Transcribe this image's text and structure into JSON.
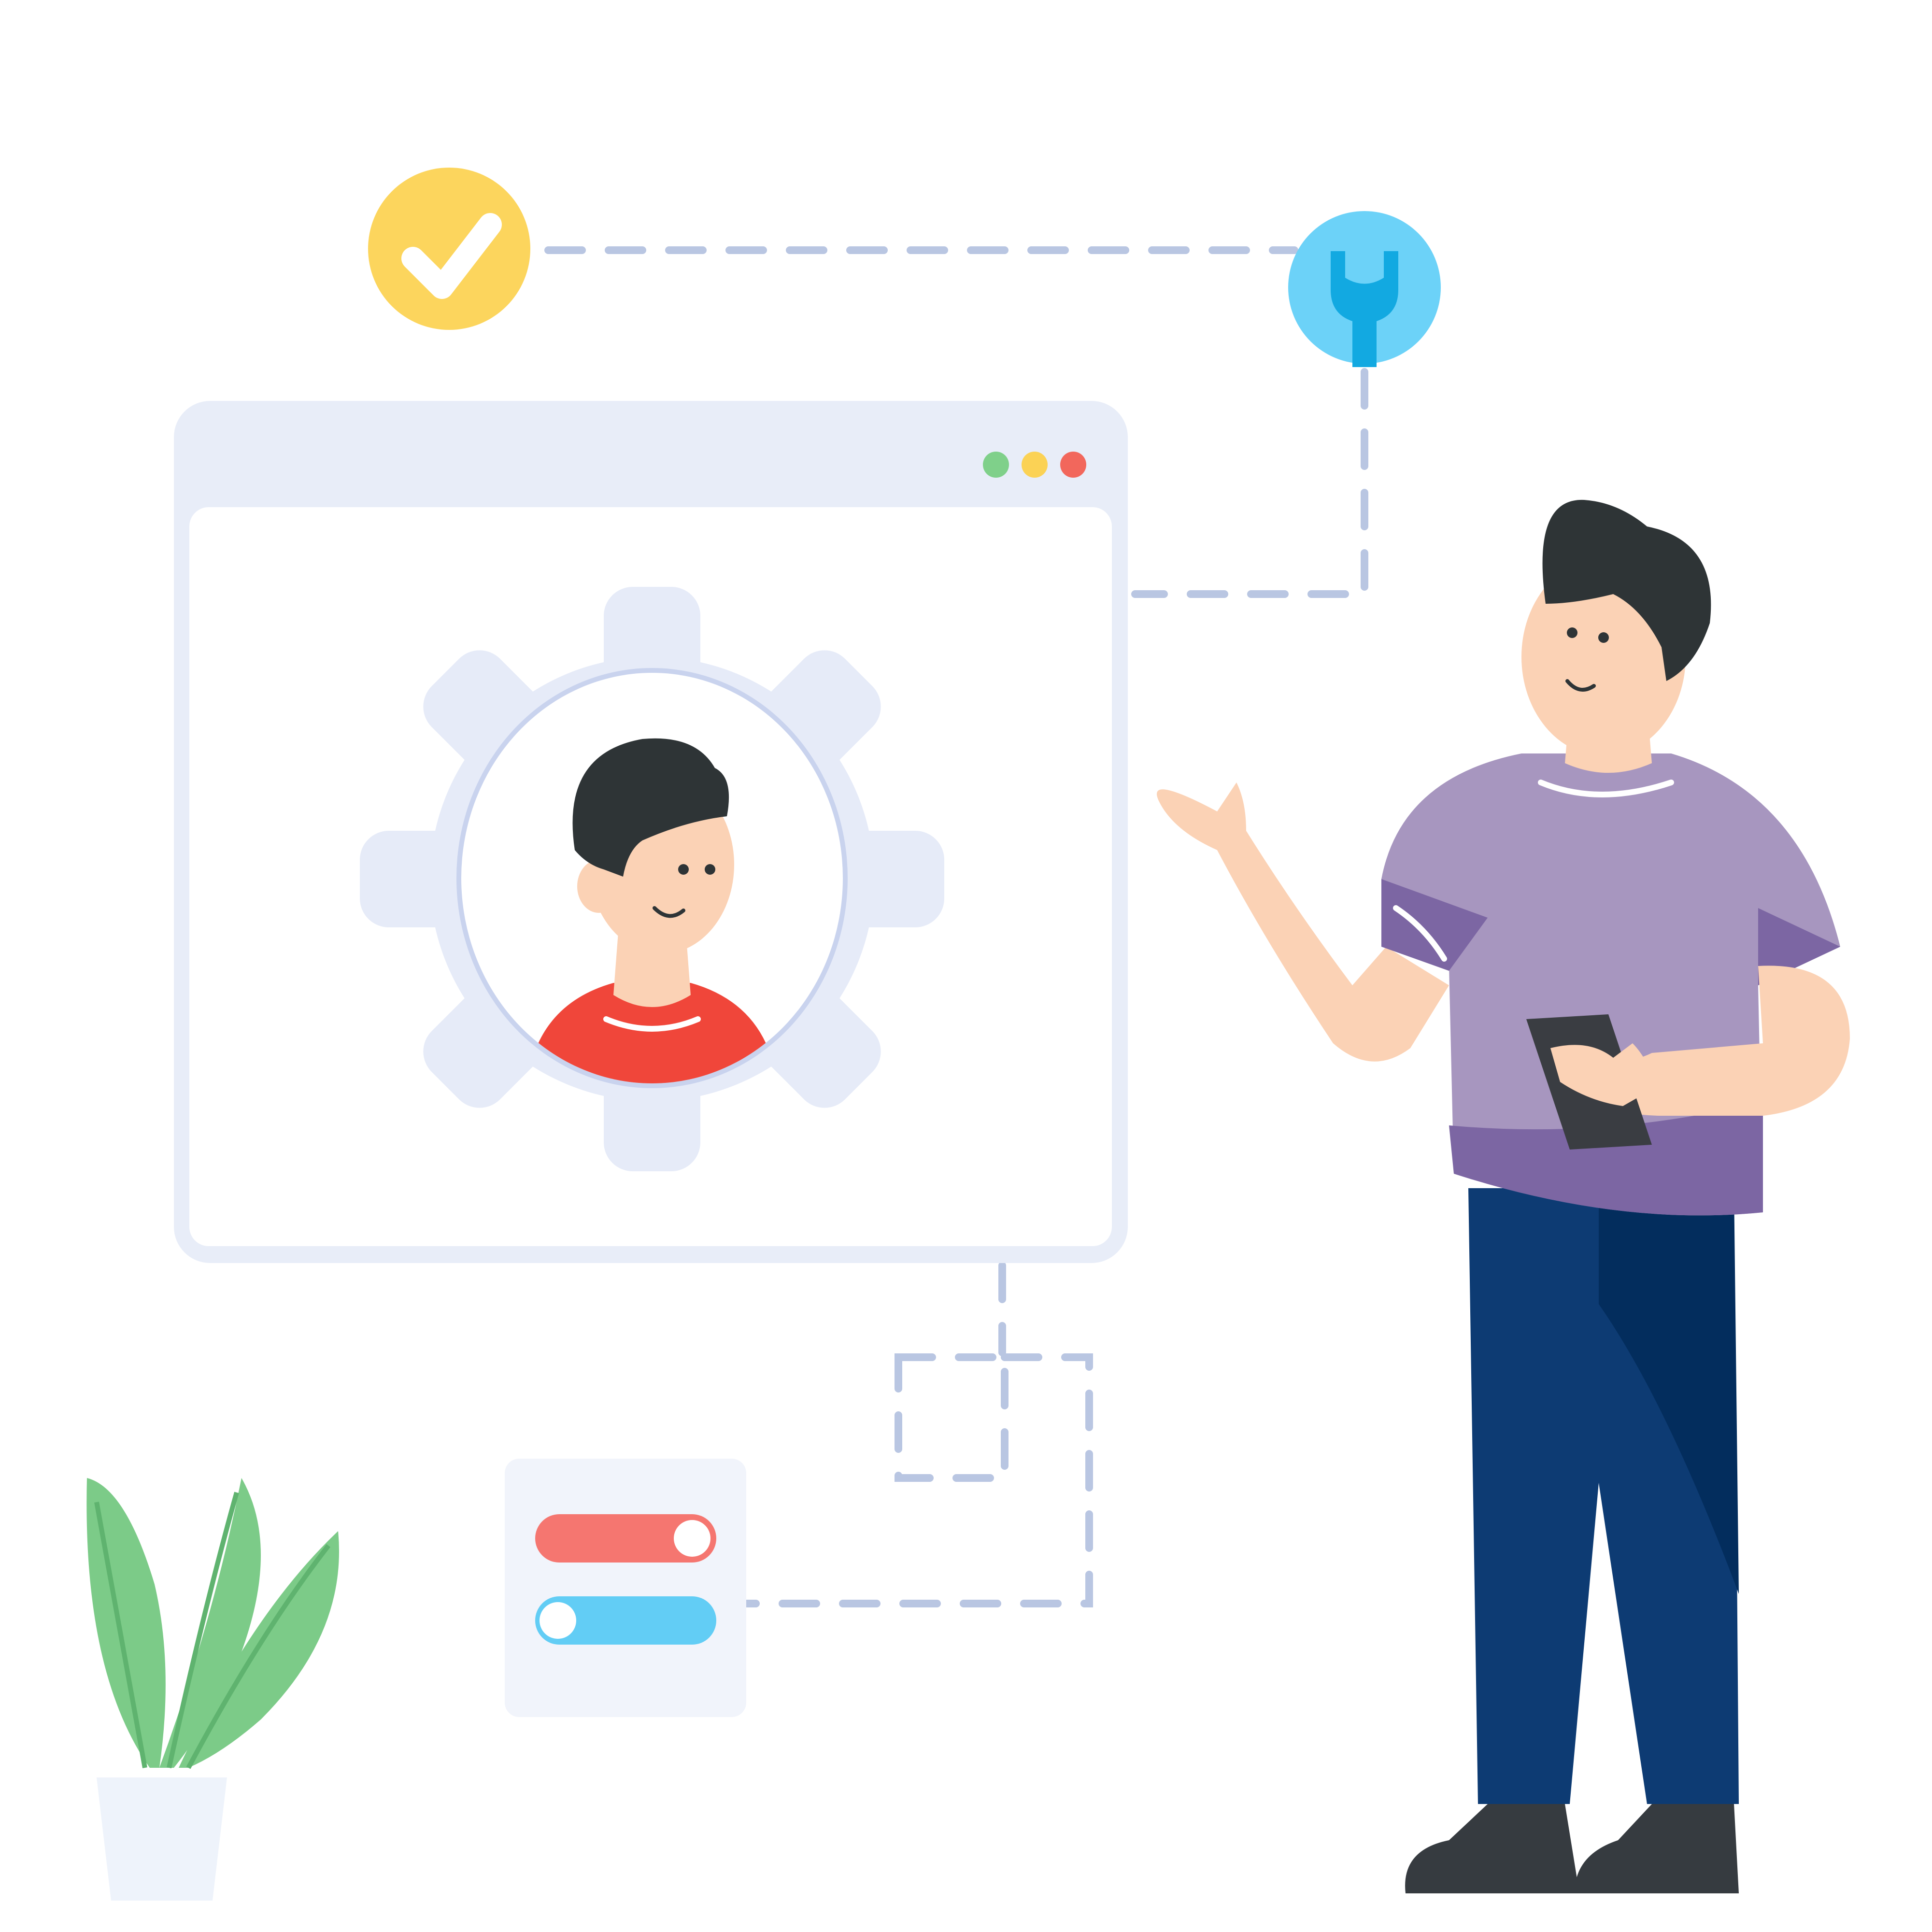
{
  "scene": {
    "kind": "flat illustration: user profile settings / account configuration",
    "palette": {
      "background": "#ffffff",
      "window_frame": "#e8edf8",
      "window_border": "#dfe6f5",
      "connector_dash": "#b9c6e2",
      "gear": "#e6ebf8",
      "avatar_ring": "#c9d3ee",
      "hair": "#2e3436",
      "skin": "#fbd2b5",
      "avatar_shirt": "#f0463a",
      "person_shirt": "#a796bf",
      "person_shirt_shade": "#7c66a3",
      "trousers": "#0d3b73",
      "trousers_shade": "#032d5d",
      "shoes": "#363b40",
      "phone": "#3a3d42",
      "check_badge": "#fcd55d",
      "wrench_badge": "#6cd2f8",
      "wrench": "#12a9e1",
      "toggle_on": "#f57670",
      "toggle_off": "#62cdf5",
      "leaf": "#7ccb88",
      "leaf_dark": "#5fb36f",
      "pot": "#eef3fb",
      "dot_green": "#7fd08a",
      "dot_yellow": "#fbd255",
      "dot_red": "#f2675c"
    },
    "icons": {
      "check_badge": "checkmark-circle-icon",
      "wrench_badge": "wrench-circle-icon",
      "profile": "user-avatar-icon",
      "gear": "gear-icon",
      "toggles": "toggle-switch-icon",
      "plant": "potted-plant-icon"
    },
    "toggles": [
      {
        "state": "on",
        "color": "#f57670"
      },
      {
        "state": "off",
        "color": "#62cdf5"
      }
    ]
  }
}
